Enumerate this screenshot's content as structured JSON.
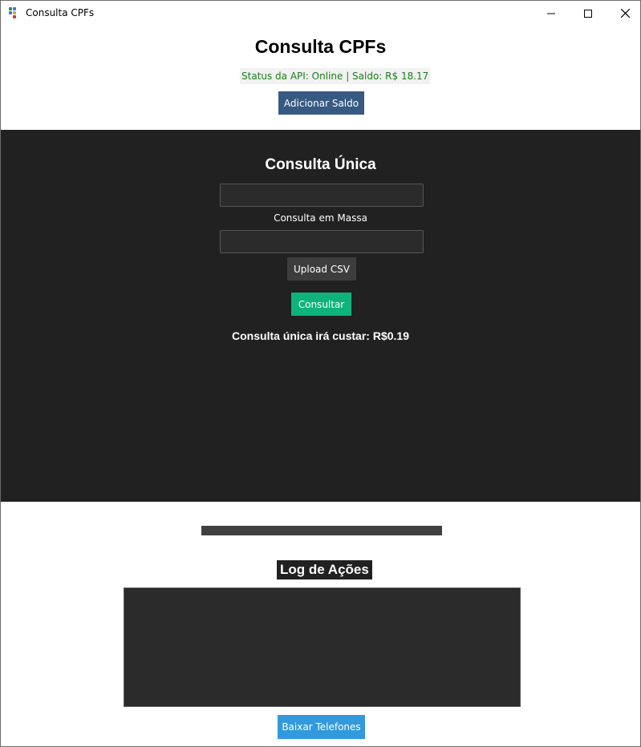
{
  "window": {
    "title": "Consulta CPFs",
    "icon": "app-dots-icon"
  },
  "header": {
    "title": "Consulta CPFs",
    "status_text": "Status da API: Online  | Saldo: R$ 18.17",
    "add_balance_label": "Adicionar Saldo"
  },
  "single": {
    "title": "Consulta Única",
    "input_value": "",
    "mass_label": "Consulta em Massa",
    "mass_input_value": "",
    "upload_label": "Upload CSV",
    "consult_label": "Consultar",
    "cost_text": "Consulta única irá custar: R$0.19"
  },
  "progress": {
    "value": 1.0
  },
  "log": {
    "title": "Log de Ações",
    "content": ""
  },
  "download_label": "Baixar Telefones",
  "colors": {
    "dark_bg": "#212121",
    "add_button": "#375a83",
    "consult_button": "#0db37b",
    "download_button": "#3399dd",
    "status_text": "#1a7f1a"
  }
}
